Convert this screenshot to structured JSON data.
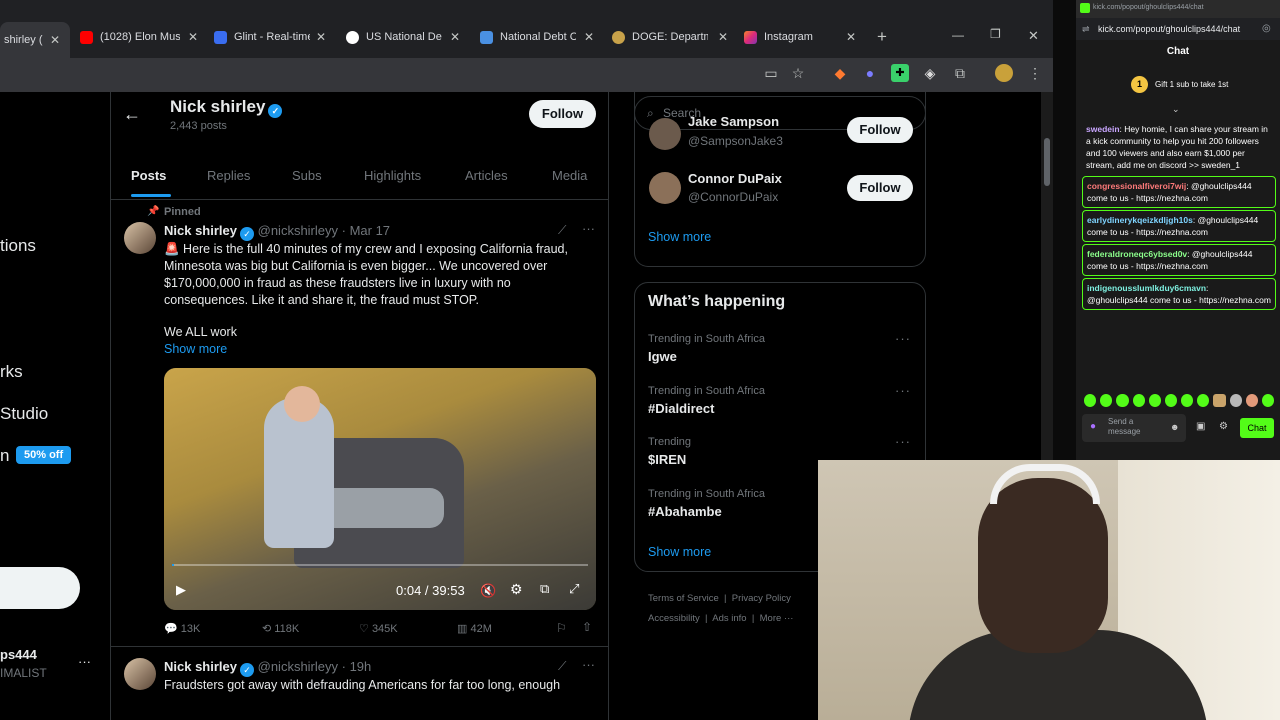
{
  "browser": {
    "tabs": [
      {
        "label": "shirley (",
        "icon": "x-logo-icon"
      },
      {
        "label": "(1028) Elon Musk",
        "icon": "youtube-icon"
      },
      {
        "label": "Glint - Real-time",
        "icon": "glint-icon"
      },
      {
        "label": "US National Deb",
        "icon": "debt-clock-icon"
      },
      {
        "label": "National Debt C",
        "icon": "debt-icon"
      },
      {
        "label": "DOGE: Departme",
        "icon": "doge-icon"
      },
      {
        "label": "Instagram",
        "icon": "instagram-icon"
      }
    ],
    "new_tab": "+"
  },
  "sidebar": {
    "items": [
      {
        "label": "tions"
      },
      {
        "label": "rks"
      },
      {
        "label": "Studio"
      },
      {
        "label": "n"
      }
    ],
    "badge": "50% off",
    "account_name": "ps444",
    "account_handle": "IMALIST",
    "more": "···"
  },
  "profile": {
    "name": "Nick shirley",
    "posts_count": "2,443 posts",
    "follow_label": "Follow",
    "tabs": [
      "Posts",
      "Replies",
      "Subs",
      "Highlights",
      "Articles",
      "Media"
    ]
  },
  "pinned_post": {
    "pinned_label": "Pinned",
    "name": "Nick shirley",
    "handle": "@nickshirleyy",
    "date": "· Mar 17",
    "text": "🚨 Here is the full 40 minutes of my crew and I exposing California fraud, Minnesota was big but California is even bigger... We uncovered over $170,000,000 in fraud as these fraudsters live in luxury with no consequences. Like it and share it, the fraud must STOP.",
    "text2": "We ALL work",
    "show_more": "Show more",
    "video_time": "0:04 / 39:53",
    "stats": {
      "replies": "13K",
      "reposts": "118K",
      "likes": "345K",
      "views": "42M"
    }
  },
  "second_post": {
    "name": "Nick shirley",
    "handle": "@nickshirleyy",
    "date": "· 19h",
    "text": "Fraudsters got away with defrauding Americans for far too long, enough"
  },
  "right": {
    "search_placeholder": "Search",
    "suggest": [
      {
        "name": "Jake Sampson",
        "handle": "@SampsonJake3",
        "follow": "Follow"
      },
      {
        "name": "Connor DuPaix",
        "handle": "@ConnorDuPaix",
        "follow": "Follow"
      }
    ],
    "show_more": "Show more",
    "happening_title": "What’s happening",
    "trends": [
      {
        "category": "Trending in South Africa",
        "name": "Igwe"
      },
      {
        "category": "Trending in South Africa",
        "name": "#Dialdirect"
      },
      {
        "category": "Trending",
        "name": "$IREN"
      },
      {
        "category": "Trending in South Africa",
        "name": "#Abahambe"
      }
    ],
    "show_more2": "Show more",
    "footer": [
      "Terms of Service",
      "Privacy Policy",
      "Accessibility",
      "Ads info",
      "More ···"
    ]
  },
  "chat": {
    "url": "kick.com/popout/ghoulclips444/chat",
    "title": "Chat",
    "gift_text": "Gift 1 sub to take 1st",
    "gift_count": "1",
    "messages": [
      {
        "user": "swedein",
        "text": "Hey homie, I can share your stream in a kick community to help you hit 200 followers and 100 viewers and also earn $1,000 per stream, add me on discord >> sweden_1",
        "boxed": false,
        "color": "#c9a6ff"
      },
      {
        "user": "congressionalfiveroi7wij",
        "text": "@ghoulclips444 come to us - https://nezhna.com",
        "boxed": true,
        "color": "#ff7a7a"
      },
      {
        "user": "earlydinerykqeizkdljgh10s",
        "text": "@ghoulclips444 come to us - https://nezhna.com",
        "boxed": true,
        "color": "#7fd4ff"
      },
      {
        "user": "federaldroneqc6ybsed0v",
        "text": "@ghoulclips444 come to us - https://nezhna.com",
        "boxed": true,
        "color": "#8cff8c"
      },
      {
        "user": "indigenousslumlkduy6cmavn",
        "text": "@ghoulclips444 come to us - https://nezhna.com",
        "boxed": true,
        "color": "#7ef0e0"
      }
    ],
    "input_placeholder": "Send a message",
    "send_label": "Chat"
  }
}
